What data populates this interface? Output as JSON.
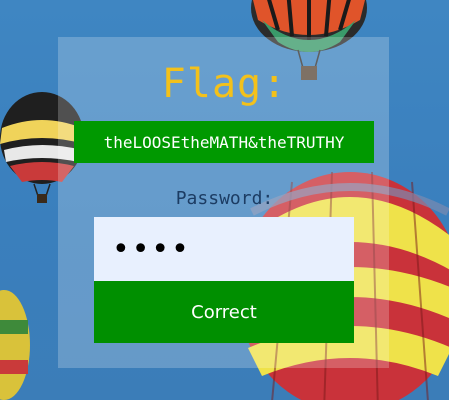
{
  "flag": {
    "heading": "Flag:",
    "value": "theLOOSEtheMATH&theTRUTHY"
  },
  "form": {
    "password_label": "Password:",
    "password_value": "abcd",
    "submit_label": "Correct"
  },
  "colors": {
    "sky": "#3f86c2",
    "flag_heading": "#f3c11b",
    "flag_box": "#009900",
    "button": "#008f00",
    "label": "#1c3c63",
    "input_bg": "#e8f0fe"
  }
}
